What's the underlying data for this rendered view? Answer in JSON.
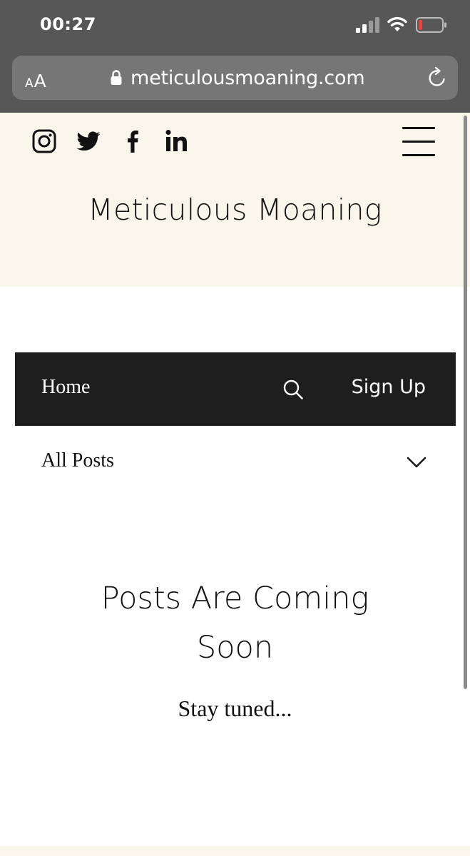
{
  "status_bar": {
    "time": "00:27"
  },
  "browser": {
    "text_size_small": "A",
    "text_size_large": "A",
    "url": "meticulousmoaning.com"
  },
  "header": {
    "social_icons": [
      "instagram-icon",
      "twitter-icon",
      "facebook-icon",
      "linkedin-icon"
    ],
    "menu_icon": "hamburger-menu-icon",
    "site_title": "Meticulous Moaning",
    "background_color": "#f8f5ea"
  },
  "blog_nav": {
    "home_label": "Home",
    "search_icon": "search-icon",
    "sign_up_label": "Sign Up",
    "background_color": "#1e1e1e"
  },
  "category_filter": {
    "selected": "All Posts"
  },
  "empty_state": {
    "title": "Posts Are Coming Soon",
    "subtitle": "Stay tuned..."
  }
}
